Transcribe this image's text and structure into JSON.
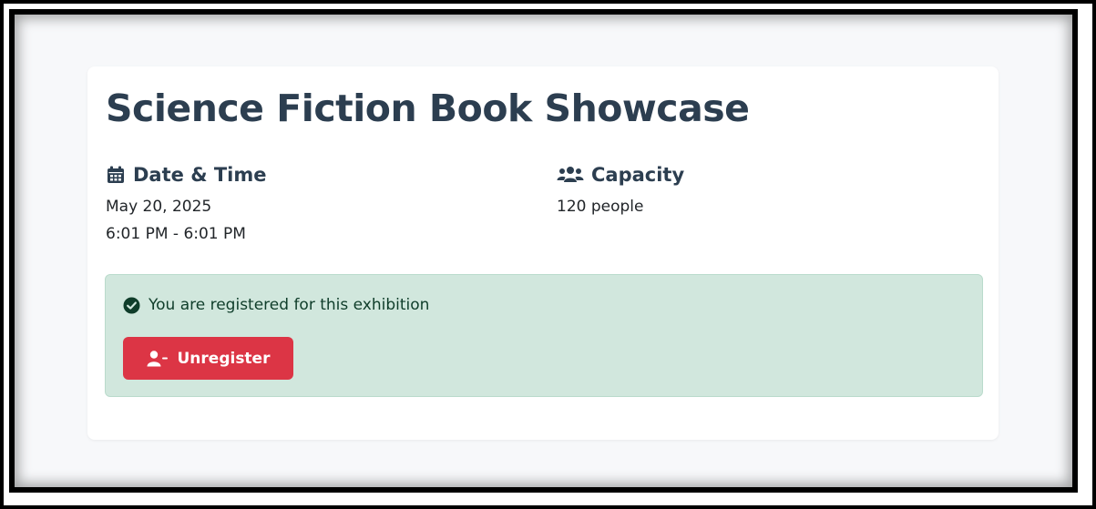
{
  "event": {
    "title": "Science Fiction Book Showcase"
  },
  "date_time": {
    "heading": "Date & Time",
    "icon": "calendar-icon",
    "date": "May 20, 2025",
    "time": "6:01 PM - 6:01 PM"
  },
  "capacity": {
    "heading": "Capacity",
    "icon": "users-icon",
    "value": "120 people"
  },
  "registration": {
    "icon": "check-circle-icon",
    "message": "You are registered for this exhibition",
    "unregister_icon": "user-minus-icon",
    "unregister_label": "Unregister"
  },
  "colors": {
    "heading": "#2c3e50",
    "alert_bg": "#d1e7dd",
    "danger": "#dc3545"
  }
}
